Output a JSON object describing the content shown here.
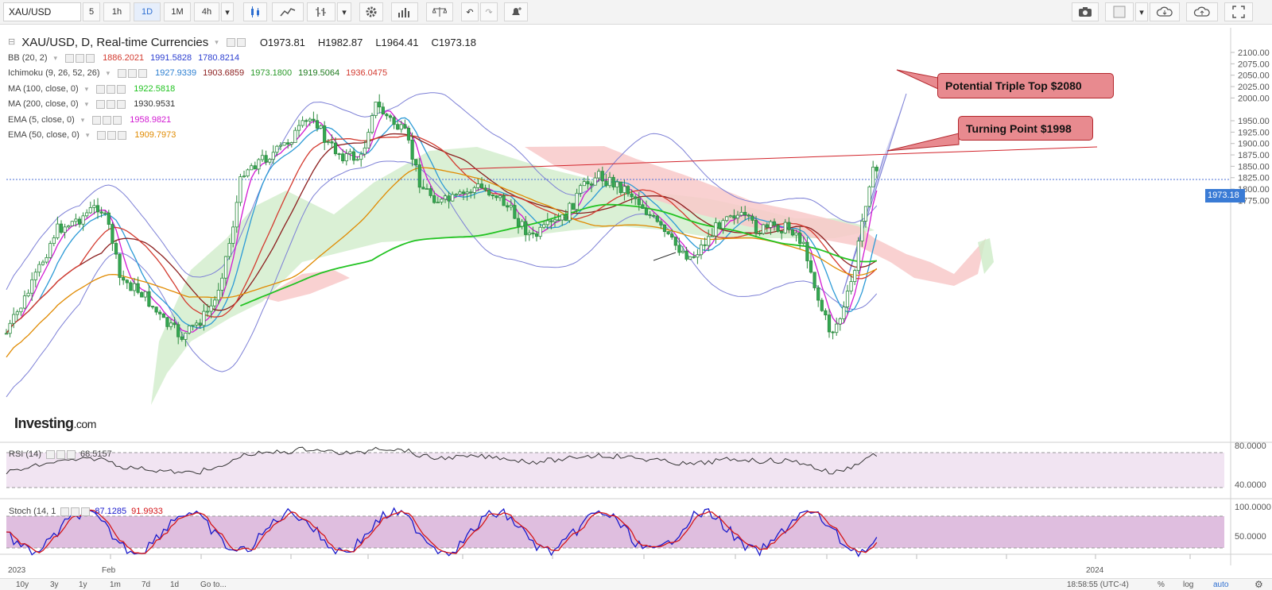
{
  "toolbar": {
    "symbol": "XAU/USD",
    "intervals": [
      "5",
      "1h",
      "1D",
      "1M",
      "4h"
    ],
    "active_interval": "1D"
  },
  "legend": {
    "title": "XAU/USD, D, Real-time Currencies",
    "open": "O1973.81",
    "high": "H1982.87",
    "low": "L1964.41",
    "close": "C1973.18",
    "indicators": [
      {
        "name": "BB (20, 2)",
        "values": [
          {
            "v": "1886.2021",
            "color": "#d33a2f"
          },
          {
            "v": "1991.5828",
            "color": "#2c3fd1"
          },
          {
            "v": "1780.8214",
            "color": "#2c3fd1"
          }
        ]
      },
      {
        "name": "Ichimoku (9, 26, 52, 26)",
        "values": [
          {
            "v": "1927.9339",
            "color": "#2c7fd1"
          },
          {
            "v": "1903.6859",
            "color": "#8b1d1d"
          },
          {
            "v": "1973.1800",
            "color": "#2a9a2a"
          },
          {
            "v": "1919.5064",
            "color": "#1e7a1e"
          },
          {
            "v": "1936.0475",
            "color": "#d33a2f"
          }
        ]
      },
      {
        "name": "MA (100, close, 0)",
        "values": [
          {
            "v": "1922.5818",
            "color": "#22c322"
          }
        ]
      },
      {
        "name": "MA (200, close, 0)",
        "values": [
          {
            "v": "1930.9531",
            "color": "#333333"
          }
        ]
      },
      {
        "name": "EMA (5, close, 0)",
        "values": [
          {
            "v": "1958.9821",
            "color": "#d21ad2"
          }
        ]
      },
      {
        "name": "EMA (50, close, 0)",
        "values": [
          {
            "v": "1909.7973",
            "color": "#e08a00"
          }
        ]
      }
    ]
  },
  "price_axis": {
    "ticks": [
      "2100.00",
      "2075.00",
      "2050.00",
      "2025.00",
      "2000.00",
      "1950.00",
      "1925.00",
      "1900.00",
      "1875.00",
      "1850.00",
      "1825.00",
      "1800.00",
      "1775.00"
    ],
    "last_price": "1973.18"
  },
  "annotations": {
    "triple_top": "Potential Triple Top $2080",
    "turning_point": "Turning Point $1998"
  },
  "brand": {
    "name": "Investing",
    "suffix": ".com"
  },
  "rsi": {
    "label": "RSI (14)",
    "value": "68.5157",
    "ticks": [
      "80.0000",
      "40.0000"
    ]
  },
  "stoch": {
    "label": "Stoch (14, 1",
    "k": "87.1285",
    "d": "91.9933",
    "ticks": [
      "100.0000",
      "50.0000"
    ]
  },
  "time_axis": {
    "labels": [
      "2023",
      "Feb",
      "2024"
    ]
  },
  "bottom_bar": {
    "ranges": [
      "10y",
      "3y",
      "1y",
      "1m",
      "7d",
      "1d",
      "Go to..."
    ],
    "clock": "18:58:55 (UTC-4)",
    "options": [
      "%",
      "log",
      "auto"
    ]
  },
  "colors": {
    "bb_band": "#7c7fd6",
    "bb_mid": "#d33a2f",
    "tenkan": "#2c9ad6",
    "kijun": "#8b1d1d",
    "ma100": "#22c322",
    "ema5": "#d21ad2",
    "ema50": "#e08a00",
    "candle": "#34a853",
    "cloud_green": "#cdebc7",
    "cloud_red": "#f8c9c9",
    "annotation": "#b3262c",
    "panel_fill": "#f1e4f2",
    "stoch_k": "#1a1acc",
    "stoch_d": "#d4161a"
  }
}
